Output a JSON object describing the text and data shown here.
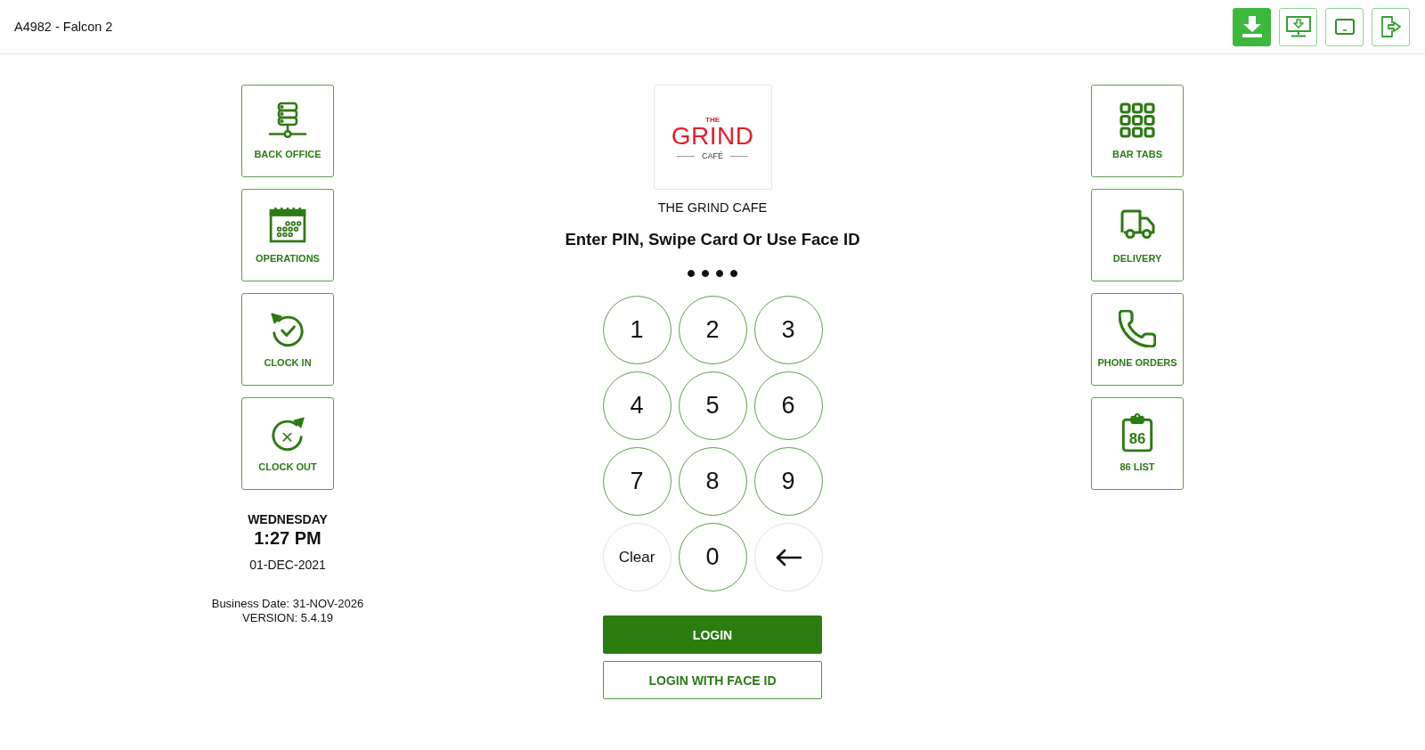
{
  "header": {
    "title": "A4982 - Falcon 2",
    "actions": [
      {
        "kind": "filled"
      },
      {
        "kind": "outline"
      },
      {
        "kind": "outline"
      },
      {
        "kind": "outline"
      }
    ]
  },
  "left_tiles": [
    {
      "label": "BACK OFFICE"
    },
    {
      "label": "OPERATIONS"
    },
    {
      "label": "CLOCK IN"
    },
    {
      "label": "CLOCK OUT"
    }
  ],
  "clock": {
    "day": "WEDNESDAY",
    "time": "1:27 PM",
    "date": "01-DEC-2021"
  },
  "system_info": {
    "business_date": "Business Date: 31-NOV-2026",
    "version": "VERSION: 5.4.19"
  },
  "store": {
    "logo": {
      "top": "THE",
      "main": "GRIND",
      "bottom": "CAFÉ"
    },
    "name": "THE GRIND CAFE"
  },
  "prompt": "Enter PIN, Swipe Card Or Use Face ID",
  "pin_dots": [
    {
      "filled": true
    },
    {
      "filled": true
    },
    {
      "filled": true
    },
    {
      "filled": true
    }
  ],
  "keypad": [
    {
      "kind": "digit",
      "label": "1"
    },
    {
      "kind": "digit",
      "label": "2"
    },
    {
      "kind": "digit",
      "label": "3"
    },
    {
      "kind": "digit",
      "label": "4"
    },
    {
      "kind": "digit",
      "label": "5"
    },
    {
      "kind": "digit",
      "label": "6"
    },
    {
      "kind": "digit",
      "label": "7"
    },
    {
      "kind": "digit",
      "label": "8"
    },
    {
      "kind": "digit",
      "label": "9"
    },
    {
      "kind": "clear",
      "label": "Clear"
    },
    {
      "kind": "digit",
      "label": "0"
    },
    {
      "kind": "backspace"
    }
  ],
  "buttons": [
    {
      "kind": "primary",
      "label": "LOGIN"
    },
    {
      "kind": "secondary",
      "label": "LOGIN WITH FACE ID"
    }
  ],
  "right_tiles": [
    {
      "label": "BAR TABS"
    },
    {
      "label": "DELIVERY"
    },
    {
      "label": "PHONE ORDERS"
    },
    {
      "label": "86 LIST",
      "icon_text": "86"
    }
  ]
}
